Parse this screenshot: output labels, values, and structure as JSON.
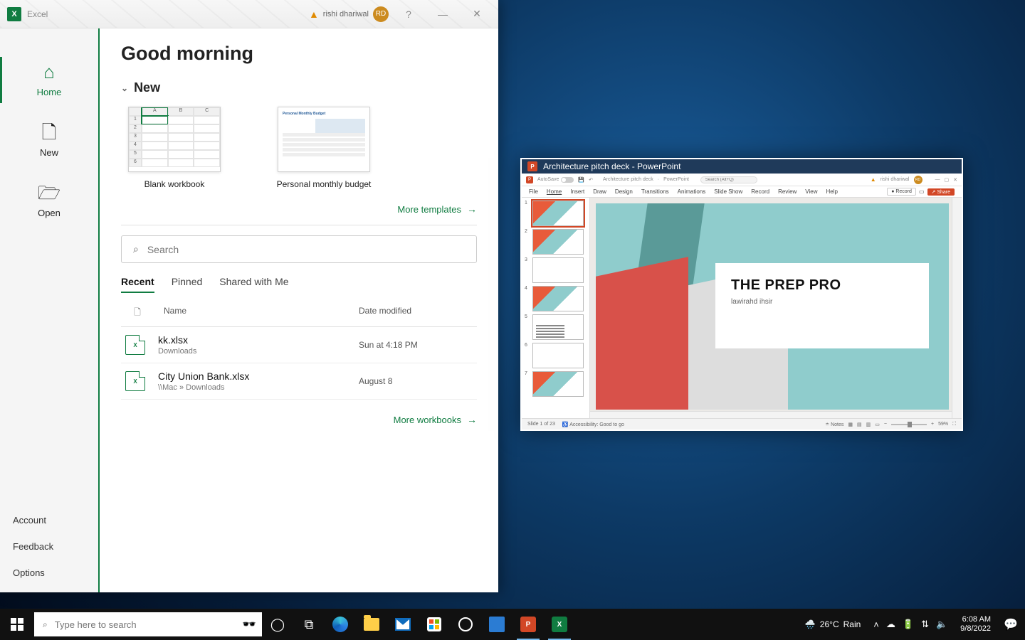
{
  "excel": {
    "app_name": "Excel",
    "user_name": "rishi dhariwal",
    "user_initials": "RD",
    "help_glyph": "?",
    "minimize_glyph": "—",
    "close_glyph": "✕",
    "sidebar": {
      "home": "Home",
      "new": "New",
      "open": "Open",
      "account": "Account",
      "feedback": "Feedback",
      "options": "Options"
    },
    "greeting": "Good morning",
    "section_new": "New",
    "templates": {
      "blank": "Blank workbook",
      "budget": "Personal monthly budget"
    },
    "more_templates": "More templates",
    "search_placeholder": "Search",
    "tabs": {
      "recent": "Recent",
      "pinned": "Pinned",
      "shared": "Shared with Me"
    },
    "columns": {
      "name": "Name",
      "date": "Date modified"
    },
    "files": [
      {
        "name": "kk.xlsx",
        "path": "Downloads",
        "date": "Sun at 4:18 PM"
      },
      {
        "name": "City Union Bank.xlsx",
        "path": "\\\\Mac » Downloads",
        "date": "August 8"
      }
    ],
    "more_workbooks": "More workbooks"
  },
  "powerpoint": {
    "window_title": "Architecture pitch deck  -  PowerPoint",
    "autosave": "AutoSave",
    "doc_name": "Architecture pitch deck",
    "app_name": "PowerPoint",
    "search_placeholder": "Search (Alt+Q)",
    "user_name": "rishi dhariwal",
    "ribbon": [
      "File",
      "Home",
      "Insert",
      "Draw",
      "Design",
      "Transitions",
      "Animations",
      "Slide Show",
      "Record",
      "Review",
      "View",
      "Help"
    ],
    "record_btn": "● Record",
    "share_btn": "Share",
    "slide_title": "THE PREP PRO",
    "slide_subtitle": "lawirahd ihsir",
    "status_left": "Slide 1 of 23",
    "status_acc": "Accessibility: Good to go",
    "notes": "Notes",
    "zoom": "59%"
  },
  "taskbar": {
    "search_placeholder": "Type here to search",
    "weather_temp": "26°C",
    "weather_cond": "Rain",
    "time": "6:08 AM",
    "date": "9/8/2022"
  }
}
